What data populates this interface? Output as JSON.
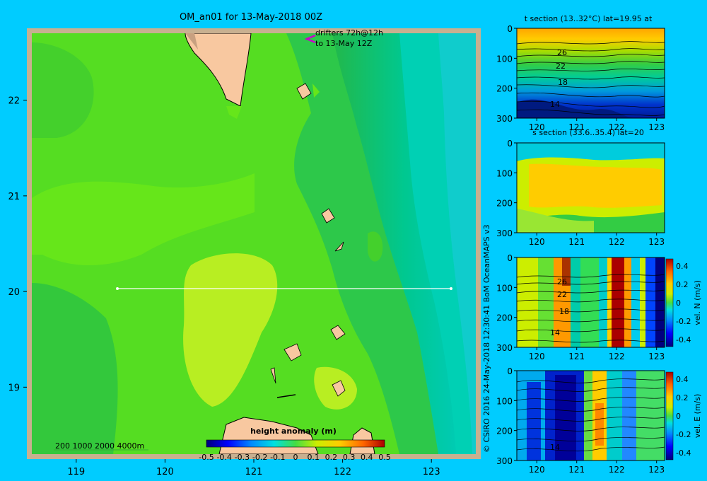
{
  "colors": {
    "background": "#00CCFF",
    "land": "#F8C8A0",
    "frame": "#C8B090",
    "white_line": "#FFFFFF",
    "drifter_arrow": "#CC00CC"
  },
  "main_map": {
    "title": "OM_an01 for 13-May-2018 00Z",
    "drifter_note_1": "drifters 72h@12h",
    "drifter_note_2": "to 13-May 12Z",
    "depth_legend": "200  1000  2000  4000m",
    "xticks": [
      "119",
      "120",
      "121",
      "122",
      "123"
    ],
    "yticks": [
      "22",
      "21",
      "20",
      "19"
    ],
    "colorbar_label": "height anomaly  (m)",
    "colorbar_ticks": [
      "-0.5",
      "-0.4",
      "-0.3",
      "-0.2",
      "-0.1",
      "0",
      "0.1",
      "0.2",
      "0.3",
      "0.4",
      "0.5"
    ]
  },
  "credit": "© CSIRO 2016   24-May-2018 12:30:41 BoM OceanMAPS v3",
  "panels": [
    {
      "title": "t section (13..32°C) lat=19.95 at",
      "contour_labels": [
        "26",
        "22",
        "18",
        "14"
      ],
      "colorbar": null
    },
    {
      "title": "s section (33.6..35.4) lat=20",
      "contour_labels": [],
      "colorbar": null
    },
    {
      "title": "",
      "contour_labels": [
        "26",
        "22",
        "18",
        "14"
      ],
      "colorbar": {
        "label": "vel. N  (m/s)",
        "ticks": [
          "0.4",
          "0.2",
          "0",
          "-0.2",
          "-0.4"
        ]
      }
    },
    {
      "title": "",
      "contour_labels": [
        "14"
      ],
      "colorbar": {
        "label": "vel. E  (m/s)",
        "ticks": [
          "0.4",
          "0.2",
          "0",
          "-0.2",
          "-0.4"
        ]
      }
    }
  ],
  "panel_xticks": [
    "120",
    "121",
    "122",
    "123"
  ],
  "panel_yticks": [
    "0",
    "100",
    "200",
    "300"
  ],
  "chart_data": [
    {
      "type": "heatmap",
      "title": "OM_an01 for 13-May-2018 00Z",
      "variable": "height anomaly (m)",
      "xlim": [
        118.5,
        123.5
      ],
      "ylim": [
        18.3,
        22.7
      ],
      "colorbar_range": [
        -0.5,
        0.5
      ],
      "section_line": {
        "lat": 20,
        "lon_from": 119.5,
        "lon_to": 123.2
      },
      "approx_field": {
        "west": 0.1,
        "central_high": 0.15,
        "east": 0.0
      }
    },
    {
      "type": "heatmap",
      "title": "t section (13..32°C) lat=19.95 at",
      "xlim": [
        119.5,
        123.2
      ],
      "ylim": [
        300,
        0
      ],
      "range": [
        13,
        32
      ]
    },
    {
      "type": "heatmap",
      "title": "s section (33.6..35.4) lat=20",
      "xlim": [
        119.5,
        123.2
      ],
      "ylim": [
        300,
        0
      ],
      "range": [
        33.6,
        35.4
      ]
    },
    {
      "type": "heatmap",
      "xlim": [
        119.5,
        123.2
      ],
      "ylim": [
        300,
        0
      ],
      "variable": "vel. N (m/s)",
      "range": [
        -0.4,
        0.4
      ]
    },
    {
      "type": "heatmap",
      "xlim": [
        119.5,
        123.2
      ],
      "ylim": [
        300,
        0
      ],
      "variable": "vel. E (m/s)",
      "range": [
        -0.4,
        0.4
      ]
    }
  ]
}
